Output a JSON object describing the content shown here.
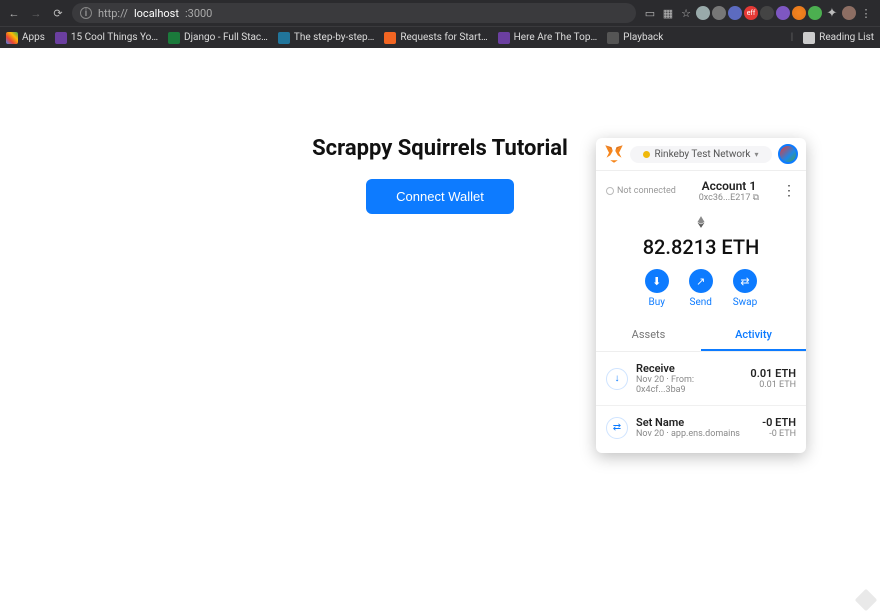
{
  "chrome": {
    "url_scheme": "http://",
    "url_host": "localhost",
    "url_port": ":3000",
    "reading_list": "Reading List",
    "bookmarks": [
      {
        "label": "Apps",
        "color": "#4285f4"
      },
      {
        "label": "15 Cool Things Yo…",
        "color": "#6b3fa0"
      },
      {
        "label": "Django - Full Stac…",
        "color": "#1b7a3b"
      },
      {
        "label": "The step-by-step…",
        "color": "#21759b"
      },
      {
        "label": "Requests for Start…",
        "color": "#f26522"
      },
      {
        "label": "Here Are The Top…",
        "color": "#6b3fa0"
      },
      {
        "label": "Playback",
        "color": "#555"
      }
    ]
  },
  "page": {
    "title": "Scrappy Squirrels Tutorial",
    "cta_label": "Connect Wallet"
  },
  "mm": {
    "network": "Rinkeby Test Network",
    "conn_status": "Not connected",
    "account_name": "Account 1",
    "account_addr": "0xc36...E217",
    "balance": "82.8213 ETH",
    "actions": {
      "buy": "Buy",
      "send": "Send",
      "swap": "Swap"
    },
    "tabs": {
      "assets": "Assets",
      "activity": "Activity"
    },
    "txs": [
      {
        "title": "Receive",
        "sub": "Nov 20 · From: 0x4cf...3ba9",
        "amt": "0.01 ETH",
        "amt_sub": "0.01 ETH",
        "icon": "↓"
      },
      {
        "title": "Set Name",
        "sub": "Nov 20 · app.ens.domains",
        "amt": "-0 ETH",
        "amt_sub": "-0 ETH",
        "icon": "⇄"
      }
    ]
  }
}
